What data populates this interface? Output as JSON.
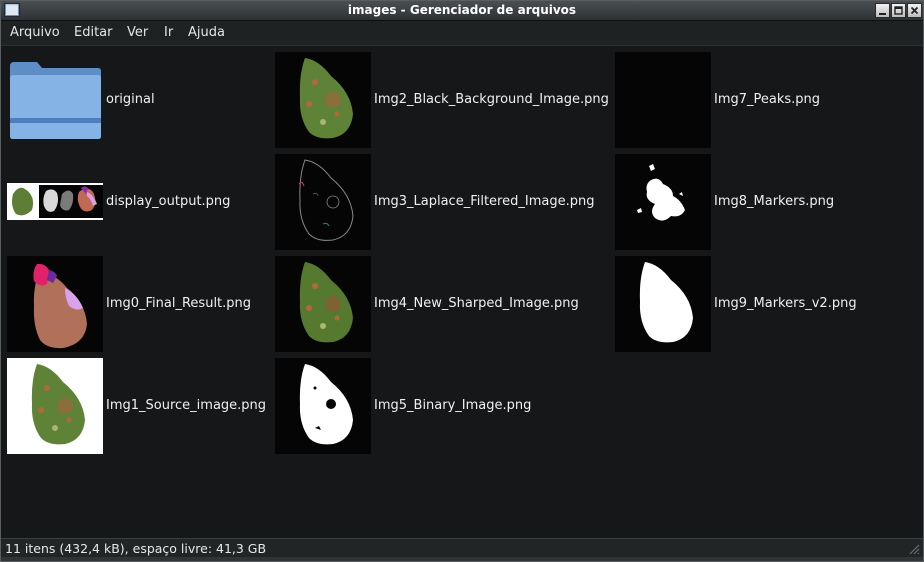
{
  "window": {
    "title": "images - Gerenciador de arquivos"
  },
  "menu": [
    "Arquivo",
    "Editar",
    "Ver",
    "Ir",
    "Ajuda"
  ],
  "files": [
    {
      "name": "original",
      "kind": "folder",
      "icon": "folder-icon"
    },
    {
      "name": "display_output.png",
      "kind": "image"
    },
    {
      "name": "Img0_Final_Result.png",
      "kind": "image"
    },
    {
      "name": "Img1_Source_image.png",
      "kind": "image"
    },
    {
      "name": "Img2_Black_Background_Image.png",
      "kind": "image"
    },
    {
      "name": "Img3_Laplace_Filtered_Image.png",
      "kind": "image"
    },
    {
      "name": "Img4_New_Sharped_Image.png",
      "kind": "image"
    },
    {
      "name": "Img5_Binary_Image.png",
      "kind": "image"
    },
    {
      "name": "Img7_Peaks.png",
      "kind": "image"
    },
    {
      "name": "Img8_Markers.png",
      "kind": "image"
    },
    {
      "name": "Img9_Markers_v2.png",
      "kind": "image"
    }
  ],
  "status": "11 itens (432,4 kB), espaço livre: 41,3 GB",
  "colors": {
    "titlebar": "#3a3f42",
    "background": "#151718",
    "leaf_green": "#5a7a35",
    "result_brown": "#b0705a"
  }
}
